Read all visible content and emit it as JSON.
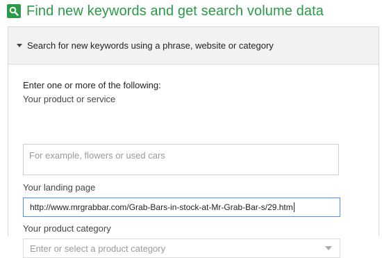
{
  "header": {
    "title": "Find new keywords and get search volume data",
    "icon": "search-icon",
    "accent_color": "#2a9a48"
  },
  "panel": {
    "toggle_label": "Search for new keywords using a phrase, website or category",
    "intro": "Enter one or more of the following:",
    "product": {
      "label": "Your product or service",
      "placeholder": "For example, flowers or used cars"
    },
    "landing": {
      "label": "Your landing page",
      "value": "http://www.mrgrabbar.com/Grab-Bars-in-stock-at-Mr-Grab-Bar-s/29.htm"
    },
    "category": {
      "label": "Your product category",
      "placeholder": "Enter or select a product category"
    }
  }
}
